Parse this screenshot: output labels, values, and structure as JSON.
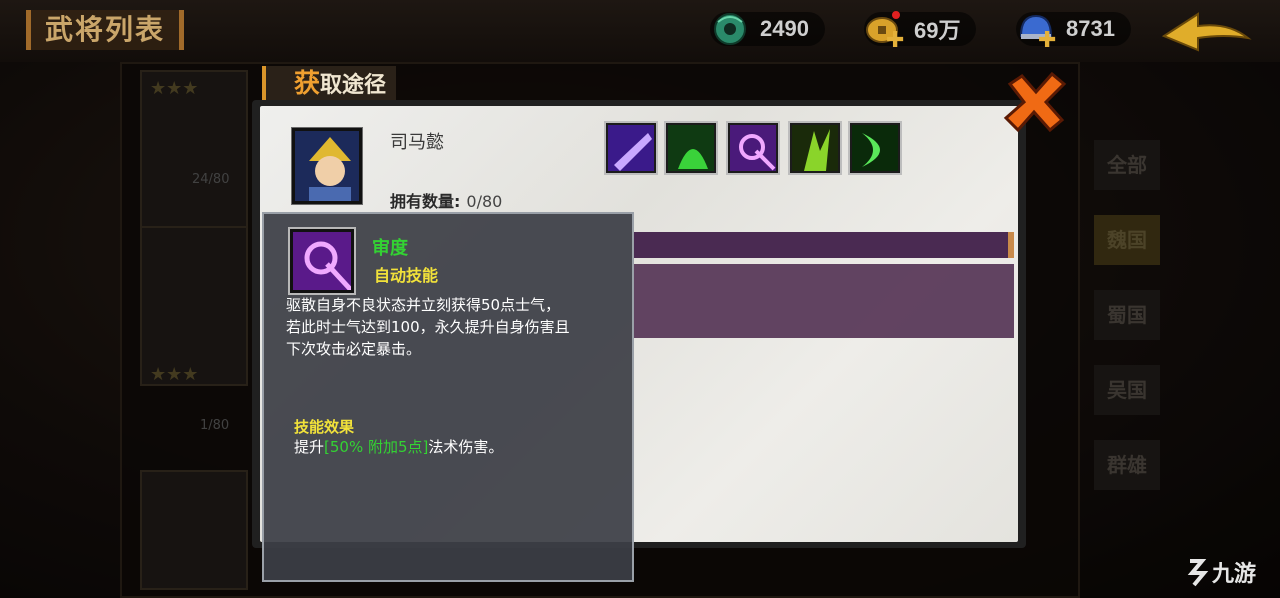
{
  "header": {
    "title": "武将列表"
  },
  "resources": [
    {
      "icon": "jade-coin-icon",
      "value": "2490"
    },
    {
      "icon": "gold-coin-icon",
      "value": "69万"
    },
    {
      "icon": "helmet-icon",
      "value": "8731"
    }
  ],
  "background_cards": [
    {
      "count": "24/80"
    },
    {
      "count": "1/80"
    }
  ],
  "faction_tabs": [
    "全部",
    "魏国",
    "蜀国",
    "吴国",
    "群雄"
  ],
  "modal": {
    "tab_first_char": "获",
    "tab_rest": "取途径",
    "hero_name": "司马懿",
    "owned_label": "拥有数量:",
    "owned_value": "0/80"
  },
  "skills": [
    {
      "icon": "purple-blade-skill-icon",
      "color": "#6a2cc8"
    },
    {
      "icon": "green-shadow-skill-icon",
      "color": "#2a9a2a"
    },
    {
      "icon": "purple-swirl-skill-icon",
      "color": "#9a2ad0"
    },
    {
      "icon": "green-claw-skill-icon",
      "color": "#5a9a1a"
    },
    {
      "icon": "green-crescent-skill-icon",
      "color": "#2ac02a"
    }
  ],
  "tooltip": {
    "name": "审度",
    "type": "自动技能",
    "desc_lines": [
      "驱散自身不良状态并立刻获得50点士气，",
      "若此时士气达到100，永久提升自身伤害且",
      "下次攻击必定暴击。"
    ],
    "effect_title": "技能效果",
    "effect_prefix": "提升",
    "effect_highlight": "[50%  附加5点]",
    "effect_suffix": "法术伤害。"
  },
  "watermark": {
    "text": "九游"
  }
}
